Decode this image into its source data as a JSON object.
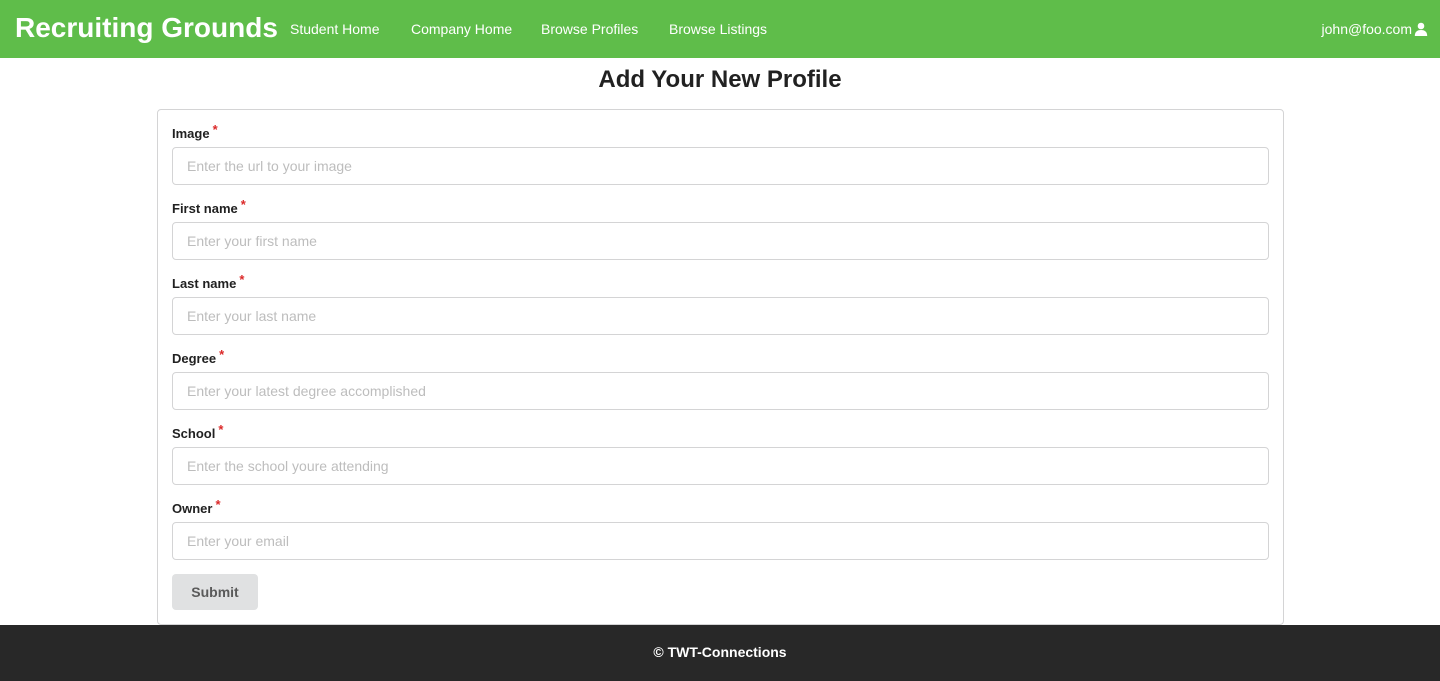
{
  "navbar": {
    "brand": "Recruiting Grounds",
    "links": [
      "Student Home",
      "Company Home",
      "Browse Profiles",
      "Browse Listings"
    ],
    "user_email": "john@foo.com",
    "user_icon": "user-icon",
    "background_color": "#5fbd4a"
  },
  "page": {
    "title": "Add Your New Profile"
  },
  "form": {
    "required_marker": "*",
    "fields": [
      {
        "label": "Image",
        "placeholder": "Enter the url to your image",
        "value": ""
      },
      {
        "label": "First name",
        "placeholder": "Enter your first name",
        "value": ""
      },
      {
        "label": "Last name",
        "placeholder": "Enter your last name",
        "value": ""
      },
      {
        "label": "Degree",
        "placeholder": "Enter your latest degree accomplished",
        "value": ""
      },
      {
        "label": "School",
        "placeholder": "Enter the school youre attending",
        "value": ""
      },
      {
        "label": "Owner",
        "placeholder": "Enter your email",
        "value": ""
      }
    ],
    "submit_label": "Submit"
  },
  "footer": {
    "text": "© TWT-Connections"
  }
}
